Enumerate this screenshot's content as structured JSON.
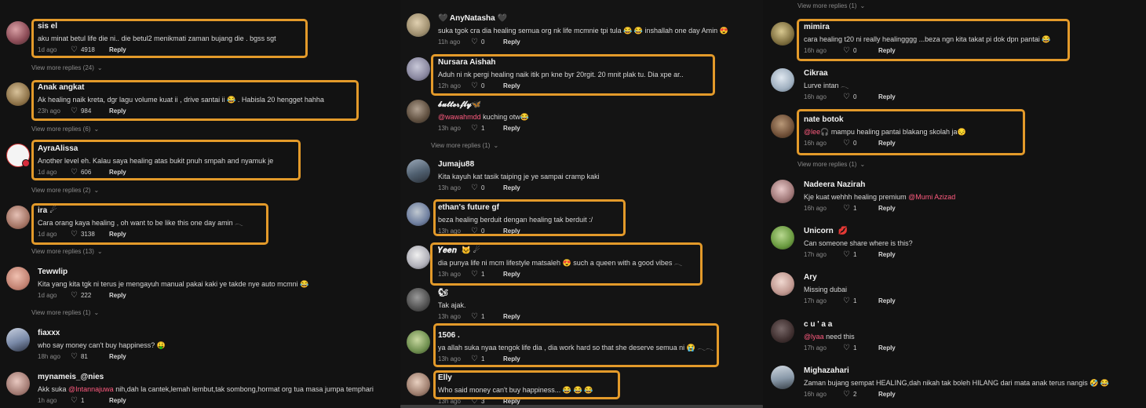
{
  "view_more": "View more replies",
  "reply_label": "Reply",
  "col1": {
    "comments": [
      {
        "username": "sis el",
        "text": "aku minat betul life die ni.. die betul2 menikmati zaman bujang die . bgss sgt",
        "time": "1d ago",
        "likes": "4918",
        "view_more_count": "(24)"
      },
      {
        "username": "Anak angkat",
        "text": "Ak healing naik kreta, dgr lagu volume kuat ii , drive santai ii 😂 . Habisla 20 hengget hahha",
        "time": "23h ago",
        "likes": "984",
        "view_more_count": "(6)"
      },
      {
        "username": "AyraAlissa",
        "text": "Another level eh. Kalau saya healing atas bukit pnuh smpah and nyamuk je",
        "time": "1d ago",
        "likes": "606",
        "view_more_count": "(2)"
      },
      {
        "username": "ira",
        "user_icon": "☄",
        "text": "Cara orang kaya healing , oh want to be like this one day amin 𓂃",
        "time": "1d ago",
        "likes": "3138",
        "view_more_count": "(13)"
      },
      {
        "username": "Tewwlip",
        "text": "Kita yang kita tgk ni terus je mengayuh manual pakai kaki ye takde nye auto mcmni 😂",
        "time": "1d ago",
        "likes": "222",
        "view_more_count": "(1)"
      },
      {
        "username": "fiaxxx",
        "text": "who say money can't buy happiness? 🤑",
        "time": "18h ago",
        "likes": "81"
      },
      {
        "username": "mynameis_@nies",
        "text_prefix": "Akk suka ",
        "mention": "@Intannajuwa",
        "text_suffix": " nih,dah la cantek,lemah lembut,tak sombong,hormat org tua masa jumpa temphari",
        "time": "1h ago",
        "likes": "1"
      }
    ]
  },
  "col2": {
    "comments": [
      {
        "username": "AnyNatasha",
        "user_prefix": "🖤",
        "user_suffix": "🖤",
        "text": "suka tgok cra dia healing semua org nk life mcmnie tpi tula 😂 😂 inshallah one day Amin 😍",
        "time": "11h ago",
        "likes": "0"
      },
      {
        "username": "Nursara Aishah",
        "text": "Aduh ni nk pergi healing naik itik pn kne byr 20rgit. 20 mnit plak tu. Dia xpe ar..",
        "time": "12h ago",
        "likes": "0"
      },
      {
        "username": "𝓫𝓾𝓽𝓽𝓮𝓻𝓯𝓵𝔂",
        "user_icon": "🦋",
        "mention": "@wawahmdd",
        "text_suffix": " kuching otw😂",
        "time": "13h ago",
        "likes": "1",
        "view_more_count": "(1)"
      },
      {
        "username": "Jumaju88",
        "text": "Kita kayuh kat tasik taiping je ye sampai cramp kaki",
        "time": "13h ago",
        "likes": "0"
      },
      {
        "username": "ethan's future gf",
        "text": "beza healing berduit dengan healing tak berduit :/",
        "time": "13h ago",
        "likes": "0"
      },
      {
        "username": "𝒀𝒆𝒆𝒏",
        "user_icon": "🐱 ☄",
        "text": "dia punya life ni mcm lifestyle matsaleh 😍  such a queen with a good vibes 𓂃",
        "time": "13h ago",
        "likes": "1"
      },
      {
        "username": "🐿",
        "text": "Tak ajak.",
        "time": "13h ago",
        "likes": "1"
      },
      {
        "username": "1506 .",
        "text": "ya allah suka nyaa tengok life dia , dia work hard so that she deserve semua ni 😭 𓂃𓂃",
        "time": "13h ago",
        "likes": "1"
      },
      {
        "username": "Elly",
        "text": "Who said money can't buy happiness... 😂 😂 😂",
        "time": "13h ago",
        "likes": "3"
      }
    ]
  },
  "col3": {
    "top_view_more_count": "(1)",
    "comments": [
      {
        "username": "mimira",
        "text": "cara healing t20 ni really healingggg ...beza ngn kita takat pi dok dpn pantai 😂",
        "time": "16h ago",
        "likes": "0"
      },
      {
        "username": "Cikraa",
        "text": "Lurve intan 𓂃",
        "time": "16h ago",
        "likes": "0"
      },
      {
        "username": "nate botok",
        "mention": "@lee",
        "text_suffix": "🎧  mampu healing pantai blakang skolah ja😔",
        "time": "16h ago",
        "likes": "0",
        "view_more_count": "(1)"
      },
      {
        "username": "Nadeera Nazirah",
        "text_prefix": "Kje kuat wehhh healing premium ",
        "mention": "@Mumi Azizad",
        "time": "16h ago",
        "likes": "1"
      },
      {
        "username": "Unicorn",
        "user_icon": "💋",
        "text": "Can someone share where is this?",
        "time": "17h ago",
        "likes": "1"
      },
      {
        "username": "Ary",
        "text": "Missing dubai",
        "time": "17h ago",
        "likes": "1"
      },
      {
        "username": "c u ' a a",
        "mention": "@lyaa",
        "text_suffix": " need this",
        "time": "17h ago",
        "likes": "1"
      },
      {
        "username": "Mighazahari",
        "text": "Zaman bujang sempat HEALING,dah nikah tak boleh HILANG dari mata anak terus nangis 🤣 😂",
        "time": "16h ago",
        "likes": "2"
      }
    ]
  },
  "colors": {
    "highlight": "#e39a2a",
    "mention": "#ff5b7f",
    "background": "#121212"
  }
}
